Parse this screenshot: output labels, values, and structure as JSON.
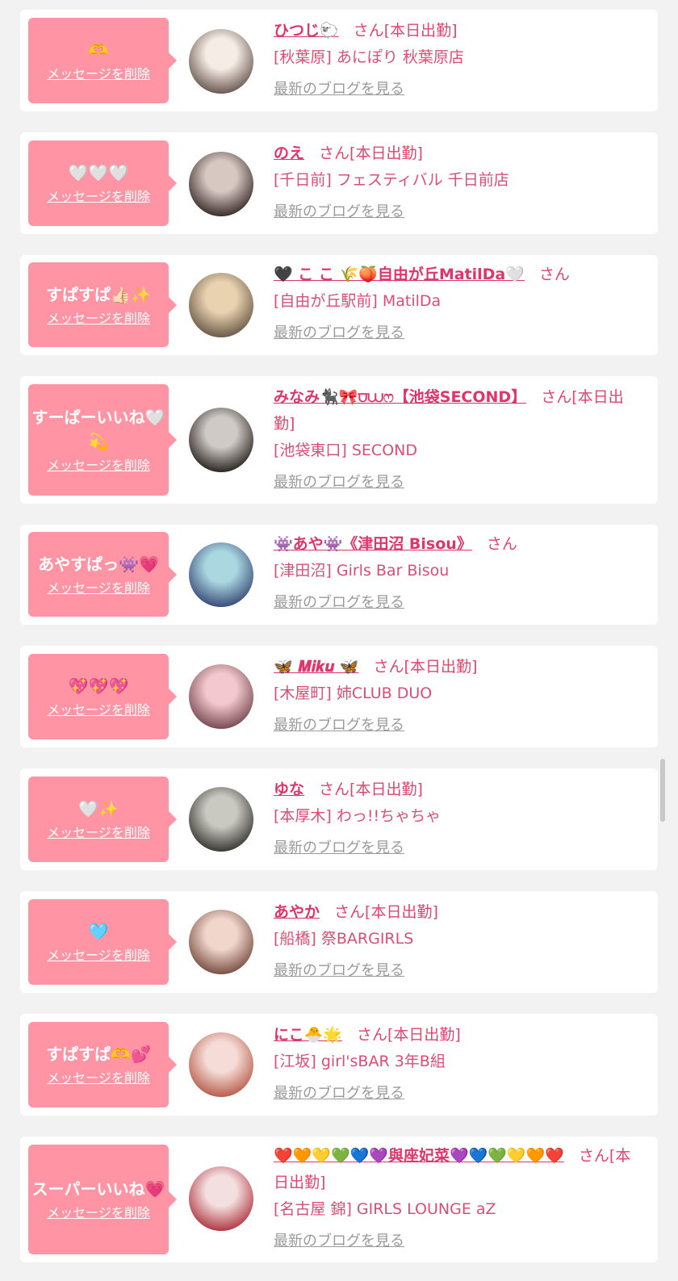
{
  "labels": {
    "delete": "メッセージを削除",
    "san": "さん",
    "blog": "最新のブログを見る"
  },
  "entries": [
    {
      "message": "🫶",
      "name": "ひつじ🐑",
      "status": "[本日出勤]",
      "shop": "[秋葉原] あにぽり 秋葉原店",
      "avatar_colors": [
        "#f6ece6",
        "#6b5a52"
      ]
    },
    {
      "message": "🤍🤍🤍",
      "name": "のえ",
      "status": "[本日出勤]",
      "shop": "[千日前] フェスティバル 千日前店",
      "avatar_colors": [
        "#d7c8c2",
        "#3b2f2c"
      ]
    },
    {
      "message": "すぱすぱ👍🏻✨",
      "name": "🖤 こ こ 🌾🍑自由が丘MatilDa🤍",
      "status": "",
      "shop": "[自由が丘駅前] MatilDa",
      "avatar_colors": [
        "#e8d2b0",
        "#6d5b4a"
      ]
    },
    {
      "message": "すーぱーいいね🤍💫",
      "name": "みなみ🐈‍⬛🎀⩌⩊ෆ【池袋SECOND】",
      "status": "[本日出勤]",
      "shop": "[池袋東口] SECOND",
      "avatar_colors": [
        "#cfcac6",
        "#2d2724"
      ]
    },
    {
      "message": "あやすぱっ👾💗",
      "name": "👾あや👾《津田沼 Bisou》",
      "status": "",
      "shop": "[津田沼] Girls Bar Bisou",
      "avatar_colors": [
        "#aad7e0",
        "#3c4d7a"
      ]
    },
    {
      "message": "💖💖💖",
      "name": "🦋 𝑴𝒊𝒌𝒖 🦋",
      "status": "[本日出勤]",
      "shop": "[木屋町] 姉CLUB DUO",
      "avatar_colors": [
        "#f3c8ce",
        "#7a4b54"
      ]
    },
    {
      "message": "🤍✨",
      "name": "ゆな",
      "status": "[本日出勤]",
      "shop": "[本厚木] わっ!!ちゃちゃ",
      "avatar_colors": [
        "#c9c9c2",
        "#3a3a34"
      ]
    },
    {
      "message": "🩵",
      "name": "あやか",
      "status": "[本日出勤]",
      "shop": "[船橋] 祭BARGIRLS",
      "avatar_colors": [
        "#f1d6cc",
        "#7b5044"
      ]
    },
    {
      "message": "すぱすぱ🫶💕",
      "name": "にこ🐣🌟",
      "status": "[本日出勤]",
      "shop": "[江坂] girl'sBAR 3年B組",
      "avatar_colors": [
        "#f5dcd6",
        "#b8604e"
      ]
    },
    {
      "message": "スーパーいいね💗",
      "name": "❤️🧡💛💚💙💜與座妃菜💜💙💚💛🧡❤️",
      "status": "[本日出勤]",
      "shop": "[名古屋 錦] GIRLS LOUNGE aZ",
      "avatar_colors": [
        "#f4dfe0",
        "#b03a44"
      ]
    }
  ]
}
